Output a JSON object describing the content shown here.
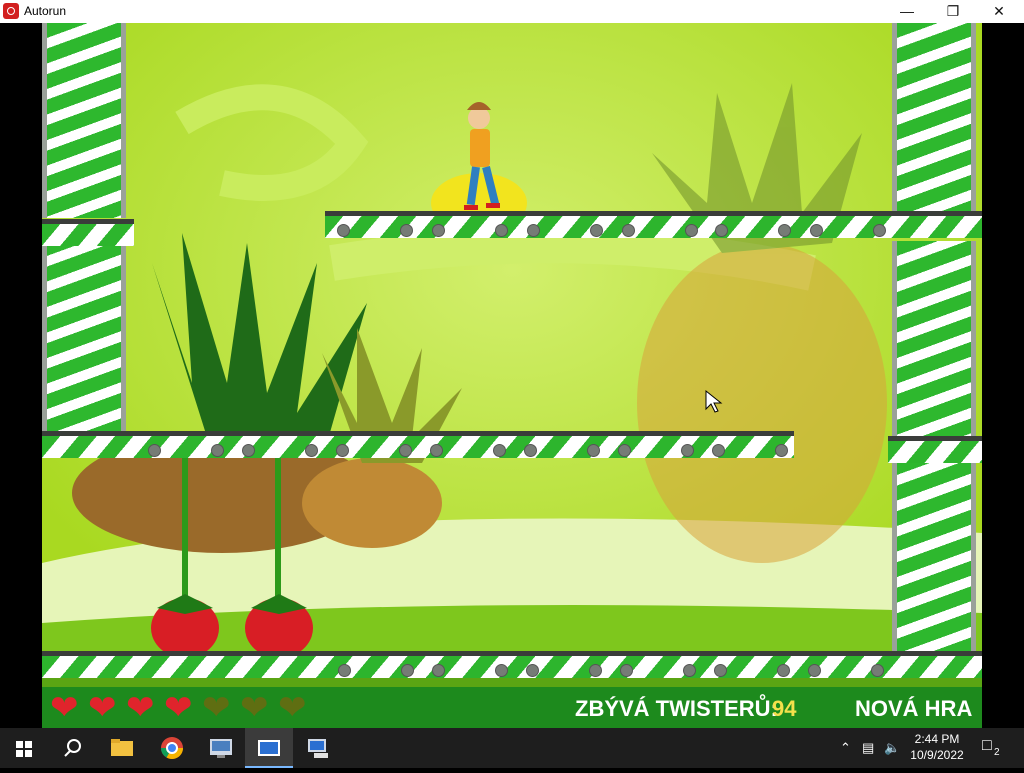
{
  "window": {
    "title": "Autorun"
  },
  "hud": {
    "lives_total": 7,
    "lives_filled": 4,
    "counter_label": "ZBÝVÁ TWISTERŮ:",
    "counter_value": "94",
    "new_game_label": "NOVÁ HRA"
  },
  "taskbar": {
    "time": "2:44 PM",
    "date": "10/9/2022",
    "notification_count": "2",
    "pinned": [
      "windows-start",
      "search",
      "file-explorer",
      "chrome",
      "control-panel",
      "autorun",
      "network-app"
    ]
  },
  "colors": {
    "background": "#b6e02e",
    "stripe_green": "#2db52d",
    "hud_bar": "#1d8a1d",
    "counter_value": "#f4e14b",
    "heart_full": "#e0242c",
    "heart_empty": "#5f6e12"
  }
}
